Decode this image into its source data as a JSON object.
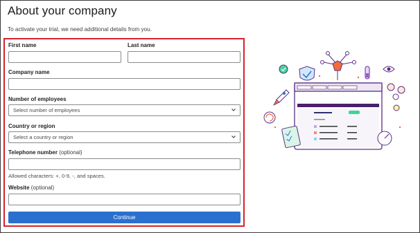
{
  "page": {
    "title": "About your company",
    "subtitle": "To activate your trial, we need additional details from you."
  },
  "form": {
    "first_name": {
      "label": "First name",
      "value": ""
    },
    "last_name": {
      "label": "Last name",
      "value": ""
    },
    "company_name": {
      "label": "Company name",
      "value": ""
    },
    "employees": {
      "label": "Number of employees",
      "placeholder": "Select number of employees"
    },
    "country": {
      "label": "Country or region",
      "placeholder": "Select a country or region"
    },
    "telephone": {
      "label": "Telephone number",
      "optional": "(optional)",
      "value": "",
      "hint": "Allowed characters: +, 0-9, -, and spaces."
    },
    "website": {
      "label": "Website",
      "optional": "(optional)",
      "value": ""
    },
    "continue_label": "Continue"
  },
  "colors": {
    "highlight_border": "#d6222b",
    "primary_button": "#2b70cf",
    "illustration_accent": "#5b2d82"
  },
  "illustration": {
    "icons": [
      "shield-check-icon",
      "rocket-icon",
      "network-hub-icon",
      "test-tube-icon",
      "eye-icon",
      "people-gear-icon",
      "lightbulb-icon",
      "refresh-icon",
      "clipboard-checklist-icon",
      "speedometer-icon",
      "award-badge-icon"
    ]
  }
}
